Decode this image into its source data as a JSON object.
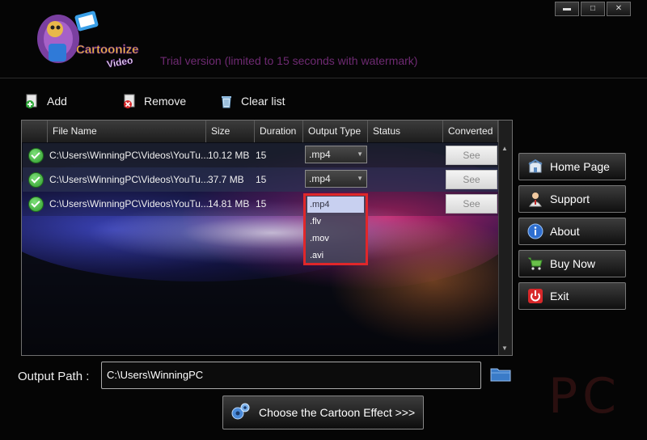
{
  "app": {
    "logo_text": "Cartoonize Video",
    "trial_notice": "Trial version (limited to 15 seconds with watermark)",
    "window_controls": [
      "▬",
      "□",
      "✕"
    ]
  },
  "toolbar": {
    "add_label": "Add",
    "remove_label": "Remove",
    "clear_label": "Clear list"
  },
  "grid": {
    "columns": [
      "File Name",
      "Size",
      "Duration",
      "Output Type",
      "Status",
      "Converted"
    ],
    "rows": [
      {
        "file": "C:\\Users\\WinningPC\\Videos\\YouTu...",
        "size": "10.12 MB",
        "duration": "15",
        "output": ".mp4",
        "status": "",
        "converted": "See"
      },
      {
        "file": "C:\\Users\\WinningPC\\Videos\\YouTu...",
        "size": "37.7 MB",
        "duration": "15",
        "output": ".mp4",
        "status": "",
        "converted": "See"
      },
      {
        "file": "C:\\Users\\WinningPC\\Videos\\YouTu...",
        "size": "14.81 MB",
        "duration": "15",
        "output": "",
        "status": "",
        "converted": "See"
      }
    ],
    "dropdown_options": [
      ".mp4",
      ".flv",
      ".mov",
      ".avi"
    ],
    "dropdown_selected": ".mp4"
  },
  "sidebar": {
    "home_label": "Home Page",
    "support_label": "Support",
    "about_label": "About",
    "buy_label": "Buy Now",
    "exit_label": "Exit"
  },
  "output": {
    "label": "Output Path :",
    "value": "C:\\Users\\WinningPC"
  },
  "choose_effect_label": "Choose the Cartoon Effect >>>",
  "watermark_text": "PC",
  "colors": {
    "highlight_border": "#e0272a",
    "trial_text": "#6e2a72",
    "background": "#050505"
  }
}
